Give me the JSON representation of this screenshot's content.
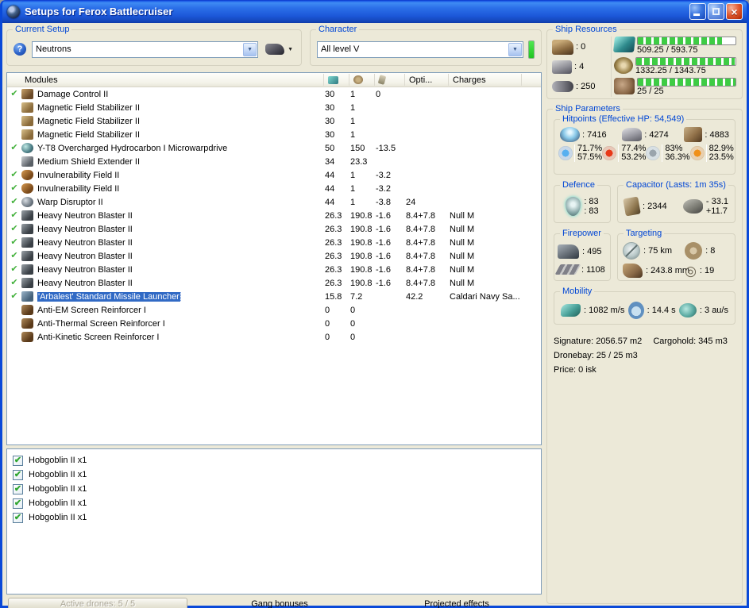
{
  "colors": {
    "titlebar_blue": "#1C57D8",
    "window_bg": "#ECE9D8",
    "group_label_blue": "#0046D5",
    "selection_blue": "#316AC5",
    "bar_green": "#3ECC44",
    "check_green": "#43B13C"
  },
  "icons": {
    "help": "?",
    "close": "×",
    "dropdown_arrow": "▼",
    "check": "✔",
    "sensor_rings": "◎"
  },
  "titlebar": {
    "title": "Setups for Ferox Battlecruiser"
  },
  "current_setup": {
    "label": "Current Setup",
    "value": "Neutrons"
  },
  "character": {
    "label": "Character",
    "value": "All level V"
  },
  "modules_panel": {
    "columns": {
      "name": "Modules",
      "opti": "Opti...",
      "charges": "Charges"
    },
    "rows": [
      {
        "active": true,
        "selected": false,
        "icon": "damage-control-icon",
        "name": "Damage Control II",
        "cpu": "30",
        "pg": "1",
        "cap": "0",
        "opti": "",
        "charges": ""
      },
      {
        "active": false,
        "selected": false,
        "icon": "magnetic-field-stabilizer-icon",
        "name": "Magnetic Field Stabilizer II",
        "cpu": "30",
        "pg": "1",
        "cap": "",
        "opti": "",
        "charges": ""
      },
      {
        "active": false,
        "selected": false,
        "icon": "magnetic-field-stabilizer-icon",
        "name": "Magnetic Field Stabilizer II",
        "cpu": "30",
        "pg": "1",
        "cap": "",
        "opti": "",
        "charges": ""
      },
      {
        "active": false,
        "selected": false,
        "icon": "magnetic-field-stabilizer-icon",
        "name": "Magnetic Field Stabilizer II",
        "cpu": "30",
        "pg": "1",
        "cap": "",
        "opti": "",
        "charges": ""
      },
      {
        "active": true,
        "selected": false,
        "icon": "microwarpdrive-icon",
        "name": "Y-T8 Overcharged Hydrocarbon I Microwarpdrive",
        "cpu": "50",
        "pg": "150",
        "cap": "-13.5",
        "opti": "",
        "charges": ""
      },
      {
        "active": false,
        "selected": false,
        "icon": "shield-extender-icon",
        "name": "Medium Shield Extender II",
        "cpu": "34",
        "pg": "23.3",
        "cap": "",
        "opti": "",
        "charges": ""
      },
      {
        "active": true,
        "selected": false,
        "icon": "invulnerability-field-icon",
        "name": "Invulnerability Field II",
        "cpu": "44",
        "pg": "1",
        "cap": "-3.2",
        "opti": "",
        "charges": ""
      },
      {
        "active": true,
        "selected": false,
        "icon": "invulnerability-field-icon",
        "name": "Invulnerability Field II",
        "cpu": "44",
        "pg": "1",
        "cap": "-3.2",
        "opti": "",
        "charges": ""
      },
      {
        "active": true,
        "selected": false,
        "icon": "warp-disruptor-icon",
        "name": "Warp Disruptor II",
        "cpu": "44",
        "pg": "1",
        "cap": "-3.8",
        "opti": "24",
        "charges": ""
      },
      {
        "active": true,
        "selected": false,
        "icon": "hybrid-turret-icon",
        "name": "Heavy Neutron Blaster II",
        "cpu": "26.3",
        "pg": "190.8",
        "cap": "-1.6",
        "opti": "8.4+7.8",
        "charges": "Null M"
      },
      {
        "active": true,
        "selected": false,
        "icon": "hybrid-turret-icon",
        "name": "Heavy Neutron Blaster II",
        "cpu": "26.3",
        "pg": "190.8",
        "cap": "-1.6",
        "opti": "8.4+7.8",
        "charges": "Null M"
      },
      {
        "active": true,
        "selected": false,
        "icon": "hybrid-turret-icon",
        "name": "Heavy Neutron Blaster II",
        "cpu": "26.3",
        "pg": "190.8",
        "cap": "-1.6",
        "opti": "8.4+7.8",
        "charges": "Null M"
      },
      {
        "active": true,
        "selected": false,
        "icon": "hybrid-turret-icon",
        "name": "Heavy Neutron Blaster II",
        "cpu": "26.3",
        "pg": "190.8",
        "cap": "-1.6",
        "opti": "8.4+7.8",
        "charges": "Null M"
      },
      {
        "active": true,
        "selected": false,
        "icon": "hybrid-turret-icon",
        "name": "Heavy Neutron Blaster II",
        "cpu": "26.3",
        "pg": "190.8",
        "cap": "-1.6",
        "opti": "8.4+7.8",
        "charges": "Null M"
      },
      {
        "active": true,
        "selected": false,
        "icon": "hybrid-turret-icon",
        "name": "Heavy Neutron Blaster II",
        "cpu": "26.3",
        "pg": "190.8",
        "cap": "-1.6",
        "opti": "8.4+7.8",
        "charges": "Null M"
      },
      {
        "active": true,
        "selected": true,
        "icon": "missile-launcher-icon",
        "name": "'Arbalest' Standard Missile Launcher",
        "cpu": "15.8",
        "pg": "7.2",
        "cap": "",
        "opti": "42.2",
        "charges": "Caldari Navy Sa..."
      },
      {
        "active": false,
        "selected": false,
        "icon": "rig-icon",
        "name": "Anti-EM Screen Reinforcer I",
        "cpu": "0",
        "pg": "0",
        "cap": "",
        "opti": "",
        "charges": ""
      },
      {
        "active": false,
        "selected": false,
        "icon": "rig-icon",
        "name": "Anti-Thermal Screen Reinforcer I",
        "cpu": "0",
        "pg": "0",
        "cap": "",
        "opti": "",
        "charges": ""
      },
      {
        "active": false,
        "selected": false,
        "icon": "rig-icon",
        "name": "Anti-Kinetic Screen Reinforcer I",
        "cpu": "0",
        "pg": "0",
        "cap": "",
        "opti": "",
        "charges": ""
      }
    ]
  },
  "drones_panel": {
    "rows": [
      {
        "checked": true,
        "label": "Hobgoblin II x1"
      },
      {
        "checked": true,
        "label": "Hobgoblin II x1"
      },
      {
        "checked": true,
        "label": "Hobgoblin II x1"
      },
      {
        "checked": true,
        "label": "Hobgoblin II x1"
      },
      {
        "checked": true,
        "label": "Hobgoblin II x1"
      }
    ]
  },
  "bottom_bar": {
    "active_drones_tab": "Active drones: 5 / 5",
    "gang_bonuses_tab": "Gang bonuses",
    "projected_effects_tab": "Projected effects"
  },
  "ship_resources": {
    "label": "Ship Resources",
    "hardpoints": [
      {
        "icon": "turret-hardpoints-icon",
        "value": ": 0"
      },
      {
        "icon": "launcher-hardpoints-icon",
        "value": ": 4"
      },
      {
        "icon": "calibration-icon",
        "value": ": 250"
      }
    ],
    "bars": [
      {
        "icon": "cpu-icon",
        "text": "509.25 / 593.75",
        "pct": 85.8
      },
      {
        "icon": "powergrid-icon",
        "text": "1332.25 / 1343.75",
        "pct": 99.1
      },
      {
        "icon": "drone-capacity-icon",
        "text": "25 / 25",
        "pct": 100
      }
    ]
  },
  "ship_parameters": {
    "label": "Ship Parameters",
    "hitpoints": {
      "label": "Hitpoints (Effective HP: 54,549)",
      "pools": [
        {
          "icon": "shield-hp-icon",
          "value": ": 7416"
        },
        {
          "icon": "armor-hp-icon",
          "value": ": 4274"
        },
        {
          "icon": "structure-hp-icon",
          "value": ": 4883"
        }
      ],
      "resists": [
        {
          "icon": "em-resist-icon",
          "top": "71.7%",
          "bottom": "57.5%"
        },
        {
          "icon": "thermal-resist-icon",
          "top": "77.4%",
          "bottom": "53.2%"
        },
        {
          "icon": "kinetic-resist-icon",
          "top": "83%",
          "bottom": "36.3%"
        },
        {
          "icon": "explosive-resist-icon",
          "top": "82.9%",
          "bottom": "23.5%"
        }
      ]
    },
    "defence": {
      "label": "Defence",
      "top": ": 83",
      "bottom": ": 83"
    },
    "capacitor": {
      "label": "Capacitor (Lasts: 1m 35s)",
      "amount": ": 2344",
      "delta_top": "- 33.1",
      "delta_bottom": "+11.7"
    },
    "firepower": {
      "label": "Firepower",
      "turret_dps": ": 495",
      "volley": ": 1108"
    },
    "targeting": {
      "label": "Targeting",
      "range": ": 75 km",
      "max_targets": ": 8",
      "scan_resolution": ": 243.8 mm",
      "sensor_strength": ": 19"
    },
    "mobility": {
      "label": "Mobility",
      "speed": ": 1082 m/s",
      "align_time": ": 14.4 s",
      "warp_speed": ": 3 au/s"
    },
    "stats": {
      "signature": "Signature: 2056.57 m2",
      "cargohold": "Cargohold: 345 m3",
      "dronebay": "Dronebay: 25 / 25 m3",
      "price": "Price: 0 isk"
    }
  }
}
